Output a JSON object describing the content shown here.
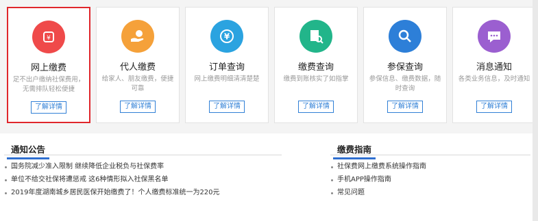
{
  "services": [
    {
      "title": "网上缴费",
      "desc": "足不出户缴纳社保费用，无需排队轻松便捷",
      "button": "了解详情",
      "color": "#ef4a4a",
      "icon": "payment-icon"
    },
    {
      "title": "代人缴费",
      "desc": "给家人、朋友缴费，便捷可靠",
      "button": "了解详情",
      "color": "#f5a13a",
      "icon": "hand-coin-icon"
    },
    {
      "title": "订单查询",
      "desc": "网上缴费明细清清楚楚",
      "button": "了解详情",
      "color": "#2ba3e0",
      "icon": "yen-order-icon"
    },
    {
      "title": "缴费查询",
      "desc": "缴费到账核实了如指掌",
      "button": "了解详情",
      "color": "#22b58a",
      "icon": "document-search-icon"
    },
    {
      "title": "参保查询",
      "desc": "参保信息、缴费数据，随时查询",
      "button": "了解详情",
      "color": "#2d7fd8",
      "icon": "search-icon"
    },
    {
      "title": "消息通知",
      "desc": "各类业务信息，及时通知",
      "button": "了解详情",
      "color": "#9b5fd0",
      "icon": "chat-bubble-icon"
    }
  ],
  "notices": {
    "title": "通知公告",
    "items": [
      "国务院减少准入限制 继续降低企业税负与社保费率",
      "单位不给交社保将遭惩戒 这6种情形拟入社保黑名单",
      "2019年度湖南城乡居民医保开始缴费了！个人缴费标准统一为220元"
    ]
  },
  "guide": {
    "title": "缴费指南",
    "items": [
      "社保费网上缴费系统操作指南",
      "手机APP操作指南",
      "常见问题"
    ]
  }
}
